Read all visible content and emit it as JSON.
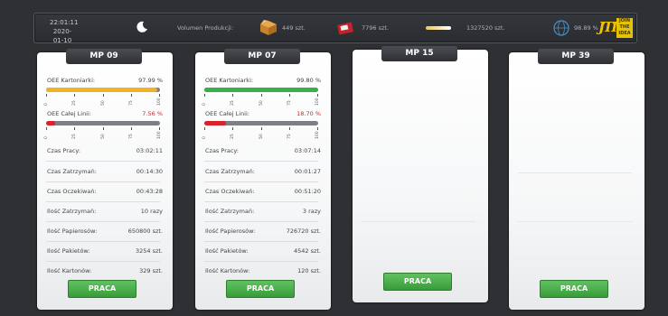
{
  "topbar": {
    "time": "22:01:11",
    "date": "2020-01-10",
    "volume_label": "Volumen Produkcji:",
    "boxes_value": "449 szt.",
    "rolls_value": "7796 szt.",
    "sticks_value": "1327520 szt.",
    "global_oee": "98.89 %",
    "logo_jti": "JTI",
    "logo_text": "JOIN THE IDEA"
  },
  "labels": {
    "oee_carton": "OEE Kartoniarki:",
    "oee_line": "OEE Całej Linii:",
    "work_time": "Czas Pracy:",
    "stop_time": "Czas Zatrzymań:",
    "wait_time": "Czas Oczekiwań:",
    "stop_count": "Ilość Zatrzymań:",
    "papers_count": "Ilość Papierosów:",
    "packets_count": "Ilość Pakietów:",
    "cartons_count": "Ilość Kartonów:"
  },
  "scale_ticks": [
    "0",
    "25",
    "50",
    "75",
    "100"
  ],
  "cards": [
    {
      "name": "MP 09",
      "oee_carton": "97.99 %",
      "oee_carton_pct": 97.99,
      "oee_carton_color": "#f1b228",
      "oee_line": "7.56 %",
      "oee_line_pct": 7.56,
      "oee_line_color": "#d9232a",
      "work_time": "03:02:11",
      "stop_time": "00:14:30",
      "wait_time": "00:43:28",
      "stop_count": "10 razy",
      "papers_count": "650800 szt.",
      "packets_count": "3254 szt.",
      "cartons_count": "329 szt.",
      "button": "PRACA"
    },
    {
      "name": "MP 07",
      "oee_carton": "99.80 %",
      "oee_carton_pct": 99.8,
      "oee_carton_color": "#35b04a",
      "oee_line": "18.70 %",
      "oee_line_pct": 18.7,
      "oee_line_color": "#d9232a",
      "work_time": "03:07:14",
      "stop_time": "00:01:27",
      "wait_time": "00:51:20",
      "stop_count": "3 razy",
      "papers_count": "726720 szt.",
      "packets_count": "4542 szt.",
      "cartons_count": "120 szt.",
      "button": "PRACA"
    },
    {
      "name": "MP 15",
      "button": "PRACA"
    },
    {
      "name": "MP 39",
      "button": "PRACA"
    }
  ]
}
